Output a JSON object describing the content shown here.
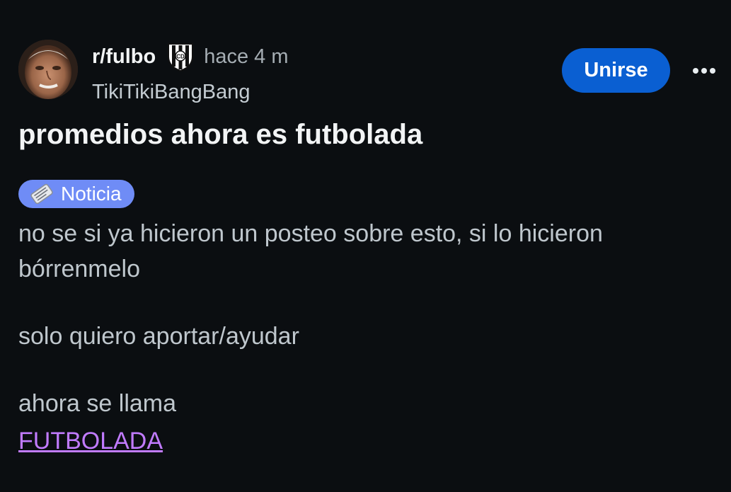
{
  "post": {
    "subreddit": "r/fulbo",
    "time": "hace 4 m",
    "author": "TikiTikiBangBang",
    "join_label": "Unirse",
    "title": "promedios ahora es futbolada",
    "flair": {
      "label": "Noticia",
      "icon": "newspaper-icon",
      "color": "#6f8cf6"
    },
    "body": {
      "line1": "no se si ya hicieron un posteo sobre esto, si lo hicieron",
      "line2": "bórrenmelo",
      "line3": "solo quiero aportar/ayudar",
      "line4": "ahora se llama",
      "link": "FUTBOLADA"
    }
  },
  "colors": {
    "background": "#0b0e11",
    "join_button": "#0a5fd2",
    "link": "#c17bff"
  },
  "icons": {
    "avatar": "user-avatar",
    "community_badge": "club-crest-icon",
    "more": "more-options-icon"
  }
}
